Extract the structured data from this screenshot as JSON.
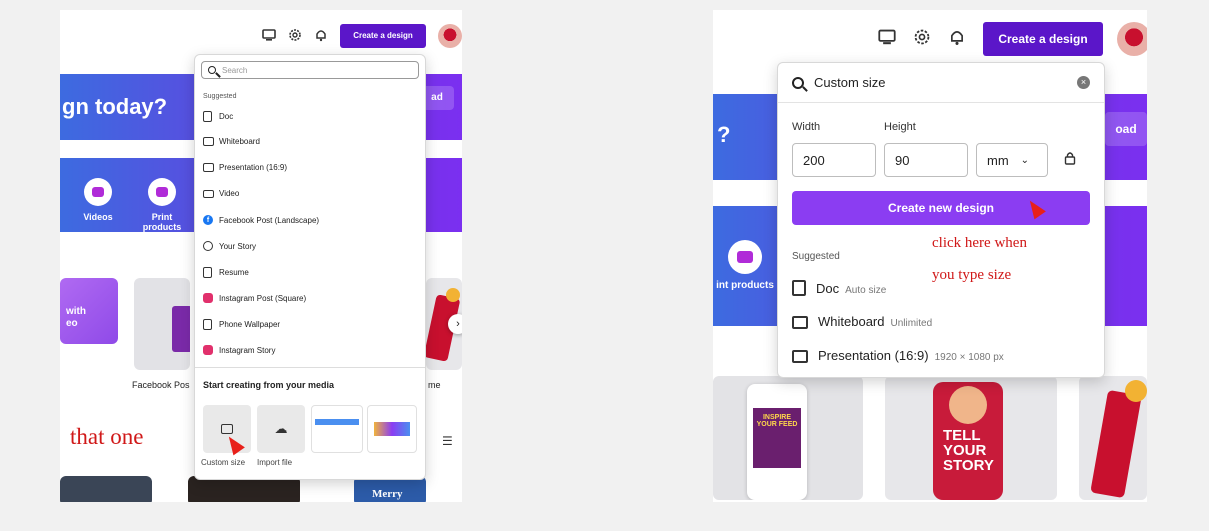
{
  "topbar": {
    "cta_label": "Create a design",
    "icons": [
      "monitor-icon",
      "gear-icon",
      "bell-icon"
    ]
  },
  "left": {
    "hero_title": "gn today?",
    "hero_btn": "ad",
    "categories": [
      "Videos",
      "Print products"
    ],
    "card_labels": [
      "Facebook Pos",
      "me"
    ],
    "card_snippets": [
      "with",
      "eo"
    ],
    "search_placeholder": "Search",
    "suggested_label": "Suggested",
    "items": [
      {
        "label": "Doc",
        "icon": "doc-icon"
      },
      {
        "label": "Whiteboard",
        "icon": "whiteboard-icon"
      },
      {
        "label": "Presentation (16:9)",
        "icon": "presentation-icon"
      },
      {
        "label": "Video",
        "icon": "video-icon"
      },
      {
        "label": "Facebook Post (Landscape)",
        "icon": "facebook-icon"
      },
      {
        "label": "Your Story",
        "icon": "story-icon"
      },
      {
        "label": "Resume",
        "icon": "resume-icon"
      },
      {
        "label": "Instagram Post (Square)",
        "icon": "instagram-icon"
      },
      {
        "label": "Phone Wallpaper",
        "icon": "phone-icon"
      },
      {
        "label": "Instagram Story",
        "icon": "instagram-icon"
      }
    ],
    "media_heading": "Start creating from your media",
    "custom_size": "Custom size",
    "import_file": "Import file",
    "annotation": "that one",
    "merry": "Merry"
  },
  "right": {
    "hero_title": "?",
    "hero_btn": "oad",
    "category": "int products",
    "search_value": "Custom size",
    "width_label": "Width",
    "height_label": "Height",
    "width_value": "200",
    "height_value": "90",
    "unit": "mm",
    "create_btn": "Create new design",
    "annotation_line1": "click here when",
    "annotation_line2": "you type size",
    "suggested_label": "Suggested",
    "suggestions": [
      {
        "label": "Doc",
        "meta": "Auto size"
      },
      {
        "label": "Whiteboard",
        "meta": "Unlimited"
      },
      {
        "label": "Presentation (16:9)",
        "meta": "1920 × 1080 px"
      }
    ],
    "card_texts": {
      "inspire": "INSPIRE YOUR FEED",
      "tell": "TELL YOUR STORY"
    }
  },
  "colors": {
    "brand": "#5b16c9",
    "create_btn": "#8b3df2",
    "annotation": "#d01818"
  }
}
